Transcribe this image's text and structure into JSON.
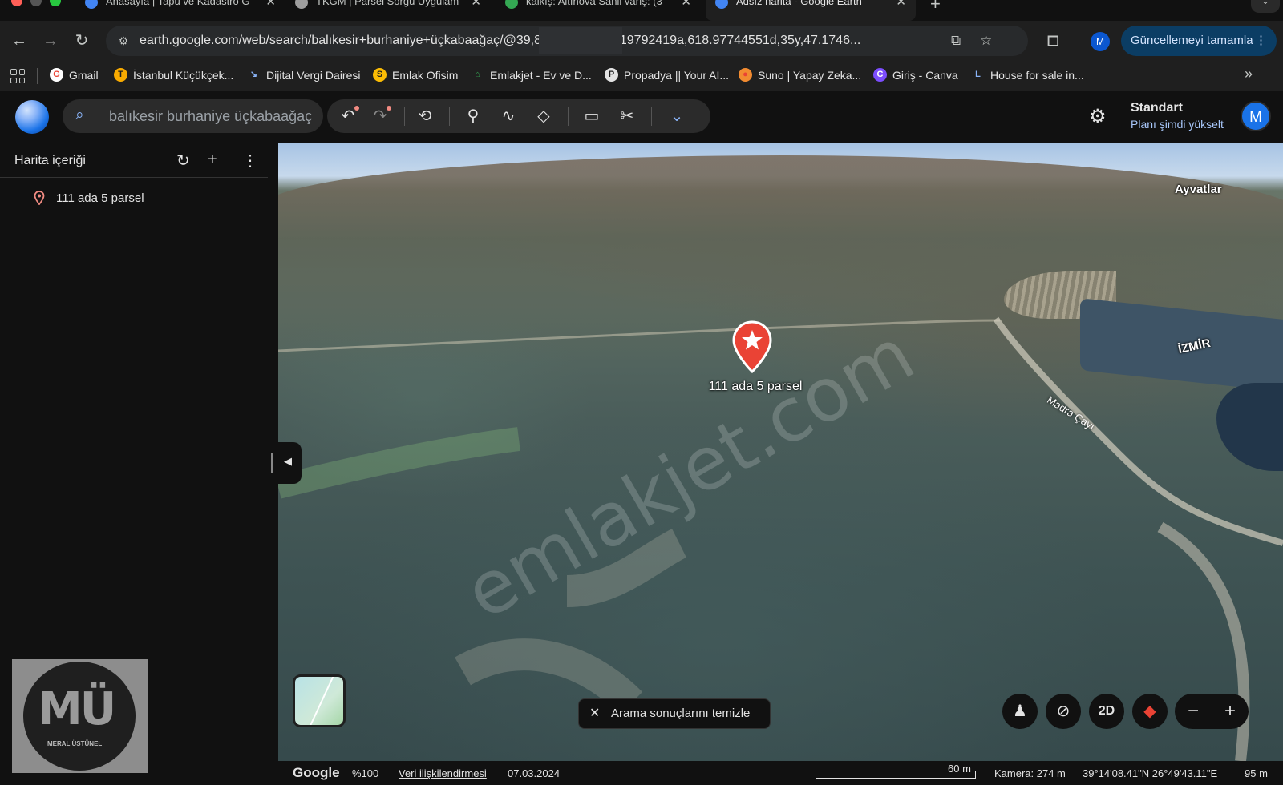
{
  "browser": {
    "tabs": [
      {
        "label": "Anasayfa | Tapu ve Kadastro G",
        "color": "#4285f4"
      },
      {
        "label": "TKGM | Parsel Sorgu Uygulam",
        "color": "#9e9e9e"
      },
      {
        "label": "kalkış: Altınova Sahil varış: (3",
        "color": "#34a853"
      },
      {
        "label": "Adsız harita - Google Earth",
        "color": "#4285f4",
        "active": true
      }
    ],
    "url": "earth.google.com/web/search/balıkesir+burhaniye+üçkabaağaç/@39,83077959,153.19792419a,618.97744551d,35y,47.1746...",
    "update_button": "Güncellemeyi tamamla",
    "profile_letter": "M"
  },
  "bookmarks": [
    {
      "label": "Gmail",
      "icon": "G",
      "color": "#ffffff",
      "text_color": "#ea4335"
    },
    {
      "label": "İstanbul Küçükçek...",
      "icon": "T",
      "color": "#f9ab00",
      "text_color": "#1f1f1f"
    },
    {
      "label": "Dijital Vergi Dairesi",
      "icon": "↘",
      "color": "transparent",
      "text_color": "#8ab4f8"
    },
    {
      "label": "Emlak Ofisim",
      "icon": "S",
      "color": "#fbbc04",
      "text_color": "#1f1f1f"
    },
    {
      "label": "Emlakjet - Ev ve D...",
      "icon": "⌂",
      "color": "transparent",
      "text_color": "#34a853"
    },
    {
      "label": "Propadya || Your AI...",
      "icon": "P",
      "color": "#e3e3e3",
      "text_color": "#1f1f1f"
    },
    {
      "label": "Suno | Yapay Zeka...",
      "icon": "●",
      "color": "#f28b30",
      "text_color": "#ea4335"
    },
    {
      "label": "Giriş - Canva",
      "icon": "C",
      "color": "#7c4dff",
      "text_color": "#ffffff"
    },
    {
      "label": "House for sale in...",
      "icon": "L",
      "color": "transparent",
      "text_color": "#8ab4f8"
    }
  ],
  "earth": {
    "search_value": "balıkesir burhaniye üçkabaağaç",
    "plan_title": "Standart",
    "plan_upgrade": "Planı şimdi yükselt",
    "avatar_letter": "M",
    "sidebar": {
      "title": "Harita içeriği",
      "items": [
        {
          "label": "111 ada 5 parsel",
          "icon": "pin-icon"
        }
      ]
    },
    "map": {
      "marker_label": "111 ada 5 parsel",
      "place_labels": [
        "Ayvatlar",
        "İZMİR"
      ],
      "river_label": "Madra Çayı",
      "watermark": "emlakjet.com",
      "clear_search": "Arama sonuçlarını temizle",
      "view_2d": "2D"
    },
    "statusbar": {
      "brand": "Google",
      "zoom": "%100",
      "data_attribution": "Veri ilişkilendirmesi",
      "date": "07.03.2024",
      "scale": "60 m",
      "camera": "Kamera: 274 m",
      "coords": "39°14'08.41\"N 26°49'43.11\"E",
      "elevation": "95 m"
    },
    "logo_watermark": {
      "letters": "MÜ",
      "caption": "MERAL ÜSTÜNEL"
    }
  },
  "colors": {
    "accent": "#8ab4f8",
    "marker": "#ea4335",
    "update_btn": "#0b3d64"
  }
}
